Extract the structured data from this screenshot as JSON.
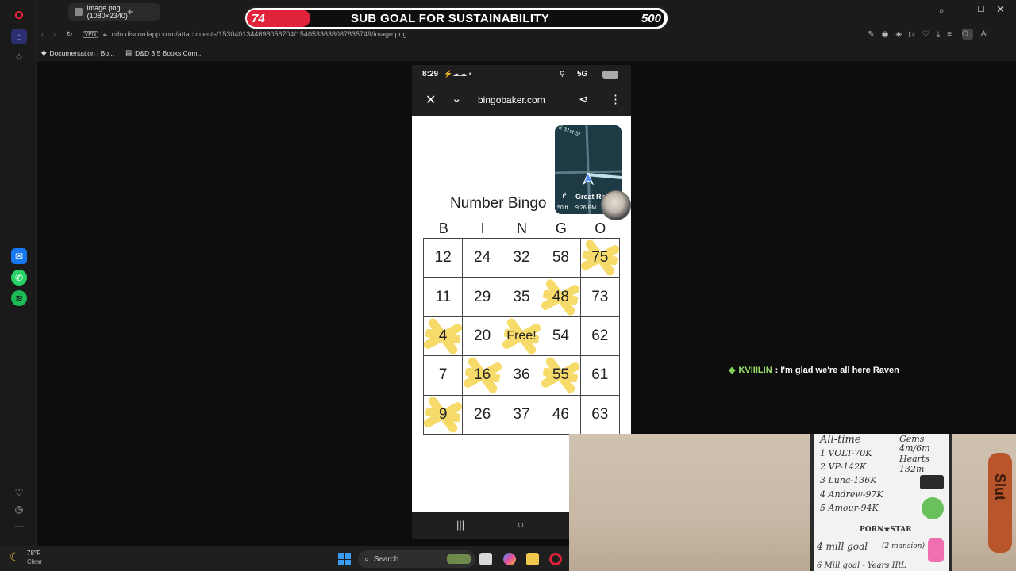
{
  "browser": {
    "tab_title": "image.png (1080×2340)",
    "url": "cdn.discordapp.com/attachments/1530401344698056704/1540533638087835749/image.png",
    "vpn_label": "VPN",
    "ai_label": "AI",
    "bookmarks": [
      {
        "label": "Documentation | Bo...",
        "icon": "diamond-icon"
      },
      {
        "label": "D&D 3.5 Books Com...",
        "icon": "document-icon"
      }
    ]
  },
  "sub_goal": {
    "current": "74",
    "title": "SUB GOAL FOR SUSTAINABILITY",
    "target": "500",
    "progress": 0.148,
    "fill_color": "#e0233a"
  },
  "phone": {
    "status": {
      "time": "8:29",
      "network": "5G"
    },
    "browser_domain": "bingobaker.com",
    "map_widget": {
      "street": "E 31st St",
      "destination": "Great Riv",
      "distance": "50 ft",
      "time": "9:26 PM"
    },
    "bingo": {
      "title": "Number Bingo",
      "headers": [
        "B",
        "I",
        "N",
        "G",
        "O"
      ],
      "rows": [
        [
          "12",
          "24",
          "32",
          "58",
          "75"
        ],
        [
          "11",
          "29",
          "35",
          "48",
          "73"
        ],
        [
          "4",
          "20",
          "Free!",
          "54",
          "62"
        ],
        [
          "7",
          "16",
          "36",
          "55",
          "61"
        ],
        [
          "9",
          "26",
          "37",
          "46",
          "63"
        ]
      ],
      "marked": [
        [
          0,
          4
        ],
        [
          1,
          3
        ],
        [
          2,
          0
        ],
        [
          2,
          2
        ],
        [
          3,
          1
        ],
        [
          3,
          3
        ],
        [
          4,
          0
        ]
      ],
      "mark_color": "#f7d85a"
    }
  },
  "chat": {
    "username": "KVIIILIN",
    "message": ": I'm glad we're all here Raven",
    "user_color": "#9be36b"
  },
  "webcam": {
    "board_lines": [
      "All-time",
      "1 VOLT-70K",
      "2 VP-142K",
      "3 Luna-136K",
      "4 Andrew-97K",
      "5 Amour-94K"
    ],
    "board_side": [
      "Gems",
      "4m/6m",
      "Hearts",
      "132m"
    ],
    "board_footer": [
      "PORN★STAR",
      "4 mill goal",
      "(2 mansion)",
      "6 Mill goal - Years IRL"
    ],
    "paddle_text": "Slut"
  },
  "taskbar": {
    "weather_temp": "78°F",
    "weather_desc": "Clear",
    "search_placeholder": "Search"
  }
}
